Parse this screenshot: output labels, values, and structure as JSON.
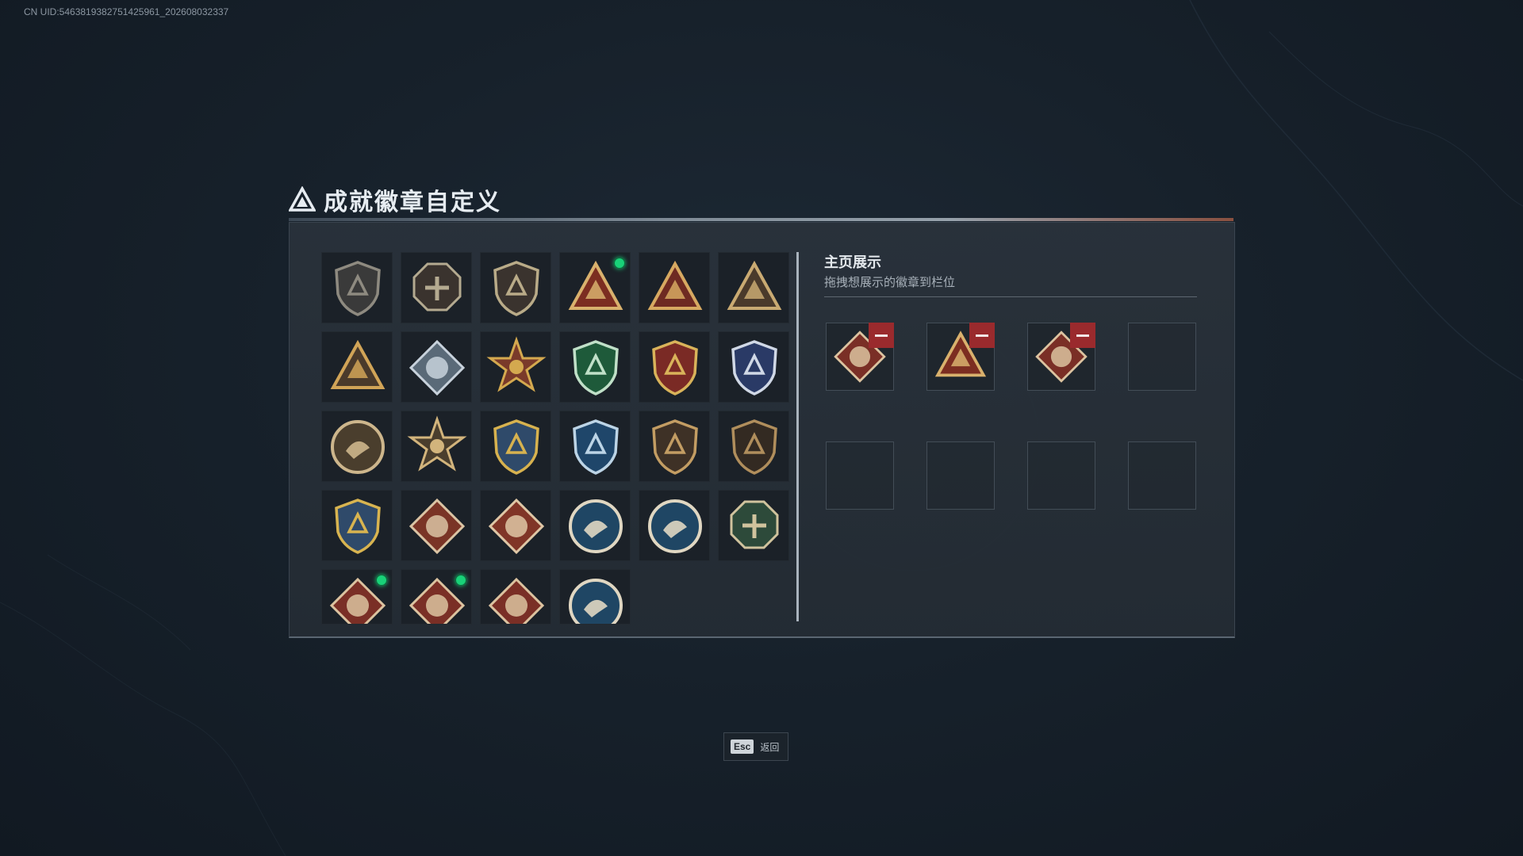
{
  "uid_text": "CN UID:5463819382751425961_202608032337",
  "title": "成就徽章自定义",
  "right_panel": {
    "title": "主页展示",
    "subtitle": "拖拽想展示的徽章到栏位"
  },
  "esc": {
    "key": "Esc",
    "label": "返回"
  },
  "badges": [
    {
      "icon": "triangle-shield-icon",
      "bg": "#3a3a3a",
      "fg": "#8e8a80",
      "shape": "shield",
      "new": false
    },
    {
      "icon": "helicopter-badge-icon",
      "bg": "#3a332e",
      "fg": "#b4aa90",
      "shape": "octagon",
      "new": false
    },
    {
      "icon": "arrowhead-shield-icon",
      "bg": "#3a332e",
      "fg": "#b9ab88",
      "shape": "shield",
      "new": false
    },
    {
      "icon": "rock-hand-triangle-icon",
      "bg": "#7c2d21",
      "fg": "#d9b16d",
      "shape": "triangle",
      "new": true
    },
    {
      "icon": "number-one-triangle-icon",
      "bg": "#6e2a22",
      "fg": "#d7a961",
      "shape": "triangle",
      "new": false
    },
    {
      "icon": "soldiers-triangle-icon",
      "bg": "#4a3a2b",
      "fg": "#c9aa72",
      "shape": "triangle",
      "new": false
    },
    {
      "icon": "bird-triangle-icon",
      "bg": "#4a3a2b",
      "fg": "#d1a457",
      "shape": "triangle",
      "new": false
    },
    {
      "icon": "silver-diamond-icon",
      "bg": "#5a6a78",
      "fg": "#c8d2dc",
      "shape": "diamond",
      "new": false
    },
    {
      "icon": "star-medal-icon",
      "bg": "#7a3a2a",
      "fg": "#d4a94f",
      "shape": "star",
      "new": false
    },
    {
      "icon": "green-shield-icon",
      "bg": "#1e5a3a",
      "fg": "#c0e0c8",
      "shape": "shield",
      "new": false
    },
    {
      "icon": "red-gold-crest-icon",
      "bg": "#7a2a25",
      "fg": "#d9b35a",
      "shape": "shield",
      "new": false
    },
    {
      "icon": "blue-silver-crest-icon",
      "bg": "#2a3a66",
      "fg": "#d0d8e6",
      "shape": "shield",
      "new": false
    },
    {
      "icon": "flower-coin-icon",
      "bg": "#4a3e2d",
      "fg": "#cdb68c",
      "shape": "circle",
      "new": false
    },
    {
      "icon": "sunburst-eye-icon",
      "bg": "#4a3e2d",
      "fg": "#d2b47c",
      "shape": "star",
      "new": false
    },
    {
      "icon": "gold-crossed-crest-icon",
      "bg": "#2f4a6a",
      "fg": "#d7b24f",
      "shape": "shield",
      "new": false
    },
    {
      "icon": "blue-crosshair-crest-icon",
      "bg": "#1f466a",
      "fg": "#bcd4e6",
      "shape": "shield",
      "new": false
    },
    {
      "icon": "rifle-shield-icon",
      "bg": "#3e3126",
      "fg": "#c39d63",
      "shape": "shield",
      "new": false
    },
    {
      "icon": "rifle-shield-dark-icon",
      "bg": "#332a22",
      "fg": "#b08e5c",
      "shape": "shield",
      "new": false
    },
    {
      "icon": "sniper-crest-icon",
      "bg": "#2f4a6a",
      "fg": "#d8b450",
      "shape": "shield",
      "new": false
    },
    {
      "icon": "wolf-diamond-icon",
      "bg": "#7a3426",
      "fg": "#dbc4a4",
      "shape": "diamond",
      "new": false
    },
    {
      "icon": "wolf-diamond-red-icon",
      "bg": "#803527",
      "fg": "#dfc7a6",
      "shape": "diamond",
      "new": false
    },
    {
      "icon": "eagle-coin-icon",
      "bg": "#1f4664",
      "fg": "#e0d7c2",
      "shape": "circle",
      "new": false
    },
    {
      "icon": "eagle-coin-alt-icon",
      "bg": "#1f4664",
      "fg": "#e0d7c2",
      "shape": "circle",
      "new": false
    },
    {
      "icon": "dragon-green-hex-icon",
      "bg": "#2d4a3a",
      "fg": "#d0c39d",
      "shape": "octagon",
      "new": false
    },
    {
      "icon": "dragon-diamond-icon",
      "bg": "#7a2f26",
      "fg": "#dcc3a0",
      "shape": "diamond",
      "new": true
    },
    {
      "icon": "dragon-diamond-alt-icon",
      "bg": "#7a2f26",
      "fg": "#dcc3a0",
      "shape": "diamond",
      "new": true
    },
    {
      "icon": "runner-diamond-icon",
      "bg": "#7a2f26",
      "fg": "#dcc3a0",
      "shape": "diamond",
      "new": false
    },
    {
      "icon": "wolf-coin-icon",
      "bg": "#1f4664",
      "fg": "#e0d7c2",
      "shape": "circle",
      "new": false
    }
  ],
  "slots": [
    {
      "icon": "dragon-diamond-icon",
      "bg": "#7a2f26",
      "fg": "#dcc3a0",
      "shape": "diamond"
    },
    {
      "icon": "rock-hand-triangle-icon",
      "bg": "#7c2d21",
      "fg": "#d9b16d",
      "shape": "triangle"
    },
    {
      "icon": "dragon-diamond-alt-icon",
      "bg": "#7a2f26",
      "fg": "#dcc3a0",
      "shape": "diamond"
    },
    null,
    null,
    null,
    null,
    null
  ]
}
